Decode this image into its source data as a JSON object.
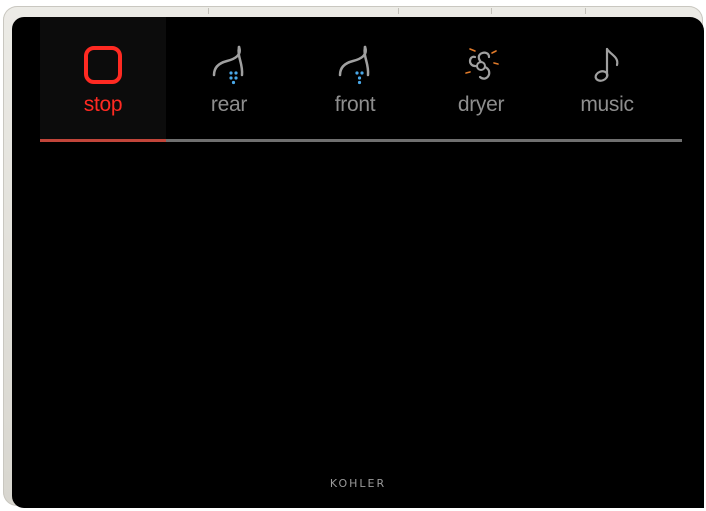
{
  "tabs": [
    {
      "id": "stop",
      "label": "stop",
      "icon": "stop-square-icon",
      "active": true
    },
    {
      "id": "rear",
      "label": "rear",
      "icon": "rear-wash-spray-icon",
      "active": false
    },
    {
      "id": "front",
      "label": "front",
      "icon": "front-wash-spray-icon",
      "active": false
    },
    {
      "id": "dryer",
      "label": "dryer",
      "icon": "dryer-fan-icon",
      "active": false
    },
    {
      "id": "music",
      "label": "music",
      "icon": "music-note-icon",
      "active": false
    }
  ],
  "brand": "KOHLER",
  "colors": {
    "active_accent": "#ff2a22",
    "inactive_text": "#8e8e8e",
    "screen_background": "#000000",
    "spray_blue": "#4aa8e8",
    "dryer_orange": "#e07a2a"
  }
}
